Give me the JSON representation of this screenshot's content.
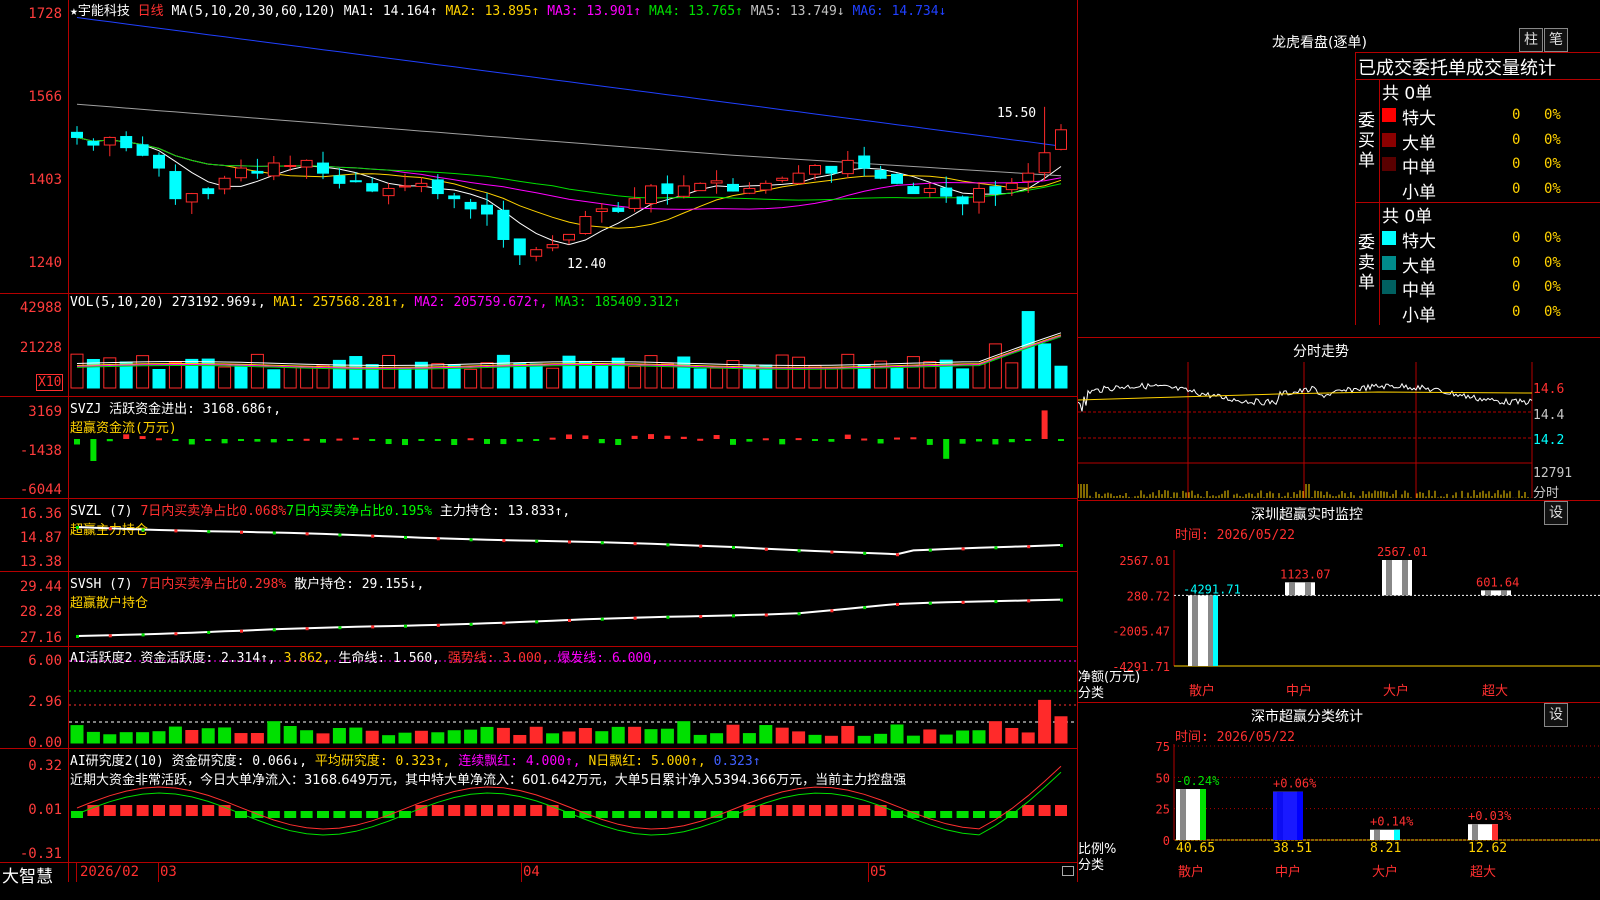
{
  "header": {
    "stock_name": "★宇能科技",
    "period": "日线",
    "ma_label": "MA(5,10,20,30,60,120)",
    "ma1": "MA1: 14.164↑",
    "ma2": "MA2: 13.895↑",
    "ma3": "MA3: 13.901↑",
    "ma4": "MA4: 13.765↑",
    "ma5": "MA5: 13.749↓",
    "ma6": "MA6: 14.734↓"
  },
  "price_panel": {
    "ticks": [
      "1728",
      "1566",
      "1403",
      "1240"
    ],
    "high_label": "15.50",
    "low_label": "12.40"
  },
  "vol_panel": {
    "title": "VOL(5,10,20)",
    "value": "273192.969↓,",
    "ma1": "MA1: 257568.281↑,",
    "ma2": "MA2: 205759.672↑,",
    "ma3": "MA3: 185409.312↑",
    "ticks": [
      "42988",
      "21228"
    ],
    "unit": "X10"
  },
  "svzj_panel": {
    "title": "SVZJ  活跃资金进出: 3168.686↑,",
    "subtitle": "超赢资金流(万元)",
    "ticks": [
      "3169",
      "-1438",
      "-6044"
    ]
  },
  "svzl_panel": {
    "title_a": "SVZL (7)",
    "title_b": "7日内买卖净占比0.068%",
    "title_c": "7日内买卖净占比0.195%",
    "title_d": "主力持仓: 13.833↑,",
    "subtitle": "超赢主力持仓",
    "ticks": [
      "16.36",
      "14.87",
      "13.38"
    ]
  },
  "svsh_panel": {
    "title_a": "SVSH (7)",
    "title_b": "7日内买卖净占比0.298%",
    "title_c": "散户持仓: 29.155↓,",
    "subtitle": "超赢散户持仓",
    "ticks": [
      "29.44",
      "28.28",
      "27.16"
    ]
  },
  "ai_active_panel": {
    "title_a": "AI活跃度2",
    "title_b": "资金活跃度: 2.314↑,",
    "title_c": "3.862,",
    "title_d": "生命线: 1.560,",
    "title_e": "强势线: 3.000,",
    "title_f": "爆发线: 6.000,",
    "ticks": [
      "6.00",
      "2.96",
      "0.00"
    ]
  },
  "ai_research_panel": {
    "title_a": "AI研究度2(10)",
    "title_b": "资金研究度: 0.066↓,",
    "title_c": "平均研究度: 0.323↑,",
    "title_d": "连续飘红: 4.000↑,",
    "title_e": "N日飘红: 5.000↑,",
    "title_f": "0.323↑",
    "commentary": "近期大资金非常活跃，今日大单净流入：3168.649万元，其中特大单净流入：601.642万元，大单5日累计净入5394.366万元，当前主力控盘强",
    "ticks": [
      "0.32",
      "0.01",
      "-0.31"
    ]
  },
  "bottom_bar": {
    "brand": "大智慧",
    "date_start": "2026/02",
    "month_labels": [
      "03",
      "04",
      "05"
    ]
  },
  "longhu": {
    "title": "龙虎看盘(逐单)",
    "btn_zhu": "柱",
    "btn_bi": "笔",
    "stat_title": "已成交委托单成交量统计",
    "buy_label": "委买单",
    "sell_label": "委卖单",
    "buy_total": "共 0单",
    "sell_total": "共 0单",
    "buy_rows": [
      {
        "label": "特大",
        "count": "0",
        "pct": "0%",
        "color": "#ff0000"
      },
      {
        "label": "大单",
        "count": "0",
        "pct": "0%",
        "color": "#8b0000"
      },
      {
        "label": "中单",
        "count": "0",
        "pct": "0%",
        "color": "#5a0000"
      },
      {
        "label": "小单",
        "count": "0",
        "pct": "0%",
        "color": "#000000"
      }
    ],
    "sell_rows": [
      {
        "label": "特大",
        "count": "0",
        "pct": "0%",
        "color": "#00ffff"
      },
      {
        "label": "大单",
        "count": "0",
        "pct": "0%",
        "color": "#008b8b"
      },
      {
        "label": "中单",
        "count": "0",
        "pct": "0%",
        "color": "#006060"
      },
      {
        "label": "小单",
        "count": "0",
        "pct": "0%",
        "color": "#000000"
      }
    ]
  },
  "intraday": {
    "title": "分时走势",
    "ticks": [
      "14.6",
      "14.4",
      "14.2"
    ],
    "vol_tick": "12791",
    "vol_label": "分时"
  },
  "shenzhen_monitor": {
    "title": "深圳超赢实时监控",
    "btn": "设",
    "time": "时间: 2026/05/22",
    "ticks": [
      "2567.01",
      "280.72",
      "-2005.47",
      "-4291.71"
    ],
    "y_label": "净额(万元)",
    "x_label": "分类",
    "categories": [
      "散户",
      "中户",
      "大户",
      "超大"
    ],
    "values": [
      -4291.71,
      1123.07,
      2567.01,
      601.64
    ],
    "value_labels": [
      "-4291.71",
      "1123.07",
      "2567.01",
      "601.64"
    ]
  },
  "shenshi_stats": {
    "title": "深市超赢分类统计",
    "btn": "设",
    "time": "时间: 2026/05/22",
    "ticks": [
      "75",
      "50",
      "25",
      "0"
    ],
    "y_label": "比例%",
    "x_label": "分类",
    "categories": [
      "散户",
      "中户",
      "大户",
      "超大"
    ],
    "values": [
      40.65,
      38.51,
      8.21,
      12.62
    ],
    "value_labels": [
      "40.65",
      "38.51",
      "8.21",
      "12.62"
    ],
    "change_labels": [
      "-0.24%",
      "+0.06%",
      "+0.14%",
      "+0.03%"
    ],
    "colors": [
      "#00e000",
      "#0000ff",
      "#00ffff",
      "#ff3030"
    ]
  },
  "colors": {
    "up": "#ff2a2a",
    "down": "#00ffff",
    "grid": "#b40000",
    "ma1": "#ffffff",
    "ma2": "#ffd200",
    "ma3": "#ff00ff",
    "ma4": "#00e000",
    "ma5": "#a0a0a0",
    "ma6": "#2040ff"
  }
}
